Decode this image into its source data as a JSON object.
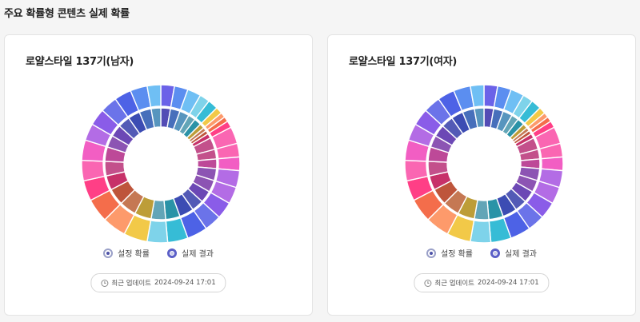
{
  "page": {
    "title": "주요 확률형 콘텐츠 실제 확률"
  },
  "legend": {
    "setting": "설정 확률",
    "actual": "실제 결과"
  },
  "updated": {
    "label": "최근 업데이트",
    "datetime": "2024-09-24 17:01"
  },
  "colors": [
    "#6b62e8",
    "#5b8ef0",
    "#6fbff4",
    "#7ed3ea",
    "#36bcd6",
    "#f2c948",
    "#fd9a6b",
    "#f46d4b",
    "#ff3f86",
    "#fa66b2",
    "#f25ec3",
    "#b36ce5",
    "#8a5ce8",
    "#6b73e9",
    "#4d62e6"
  ],
  "chart_data": [
    {
      "type": "donut",
      "title": "로얄스타일 137기(남자)",
      "series": [
        {
          "name": "설정 확률",
          "values": [
            4,
            4,
            4,
            3,
            3,
            2,
            1.5,
            1.5,
            2,
            5,
            4,
            4,
            5,
            5,
            5,
            5,
            6,
            6,
            6,
            7,
            7,
            7,
            6,
            6,
            6,
            5,
            5,
            5,
            5,
            5,
            4
          ]
        },
        {
          "name": "실제 결과",
          "values": [
            4,
            4,
            4,
            3,
            3,
            2,
            1.5,
            1.5,
            2,
            5,
            4,
            4,
            5,
            5,
            5,
            5,
            6,
            6,
            6,
            7,
            7,
            7,
            6,
            6,
            6,
            5,
            5,
            5,
            5,
            5,
            4
          ]
        }
      ]
    },
    {
      "type": "donut",
      "title": "로얄스타일 137기(여자)",
      "series": [
        {
          "name": "설정 확률",
          "values": [
            4,
            4,
            4,
            3,
            3,
            2,
            1.5,
            1.5,
            2,
            5,
            4,
            4,
            5,
            5,
            5,
            5,
            6,
            6,
            6,
            7,
            7,
            7,
            6,
            6,
            6,
            5,
            5,
            5,
            5,
            5,
            4
          ]
        },
        {
          "name": "실제 결과",
          "values": [
            4,
            4,
            4,
            3,
            3,
            2,
            1.5,
            1.5,
            2,
            5,
            4,
            4,
            5,
            5,
            5,
            5,
            6,
            6,
            6,
            7,
            7,
            7,
            6,
            6,
            6,
            5,
            5,
            5,
            5,
            5,
            4
          ]
        }
      ]
    }
  ]
}
